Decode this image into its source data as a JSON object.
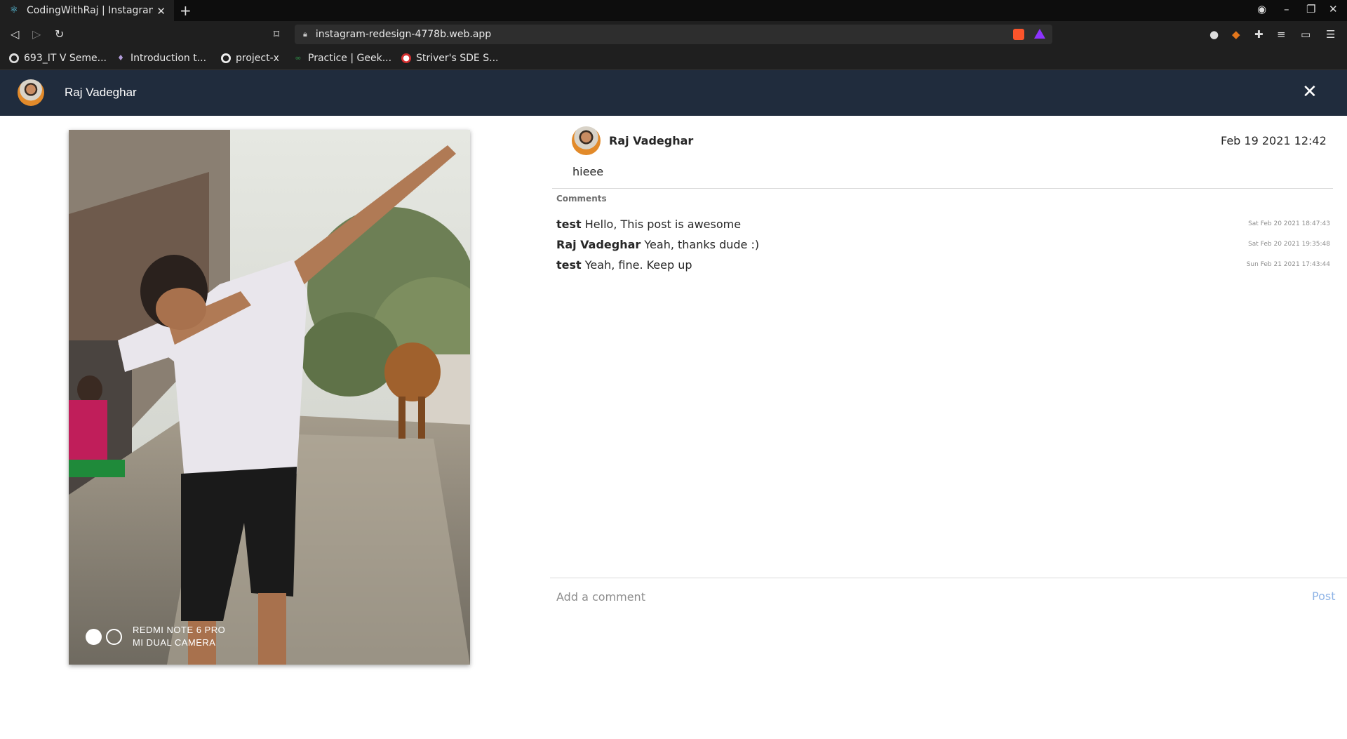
{
  "browser": {
    "tab_title": "CodingWithRaj | Instagram",
    "url": "instagram-redesign-4778b.web.app",
    "bookmarks": [
      {
        "label": "693_IT V Seme..."
      },
      {
        "label": "Introduction t..."
      },
      {
        "label": "project-x"
      },
      {
        "label": "Practice | Geek..."
      },
      {
        "label": "Striver's SDE S..."
      }
    ]
  },
  "header": {
    "username": "Raj Vadeghar"
  },
  "photo": {
    "watermark_line1": "REDMI NOTE 6 PRO",
    "watermark_line2": "MI DUAL CAMERA"
  },
  "post": {
    "username": "Raj Vadeghar",
    "date": "Feb 19 2021 12:42",
    "caption": "hieee",
    "comments_label": "Comments",
    "comments": [
      {
        "user": "test",
        "text": "Hello, This post is awesome",
        "time": "Sat Feb 20 2021 18:47:43"
      },
      {
        "user": "Raj Vadeghar",
        "text": "Yeah, thanks dude :)",
        "time": "Sat Feb 20 2021 19:35:48"
      },
      {
        "user": "test",
        "text": "Yeah, fine. Keep up",
        "time": "Sun Feb 21 2021 17:43:44"
      }
    ],
    "add_comment_placeholder": "Add a comment",
    "post_button": "Post"
  },
  "colors": {
    "header_bg": "#202c3d",
    "post_button": "#8fb4e6"
  }
}
